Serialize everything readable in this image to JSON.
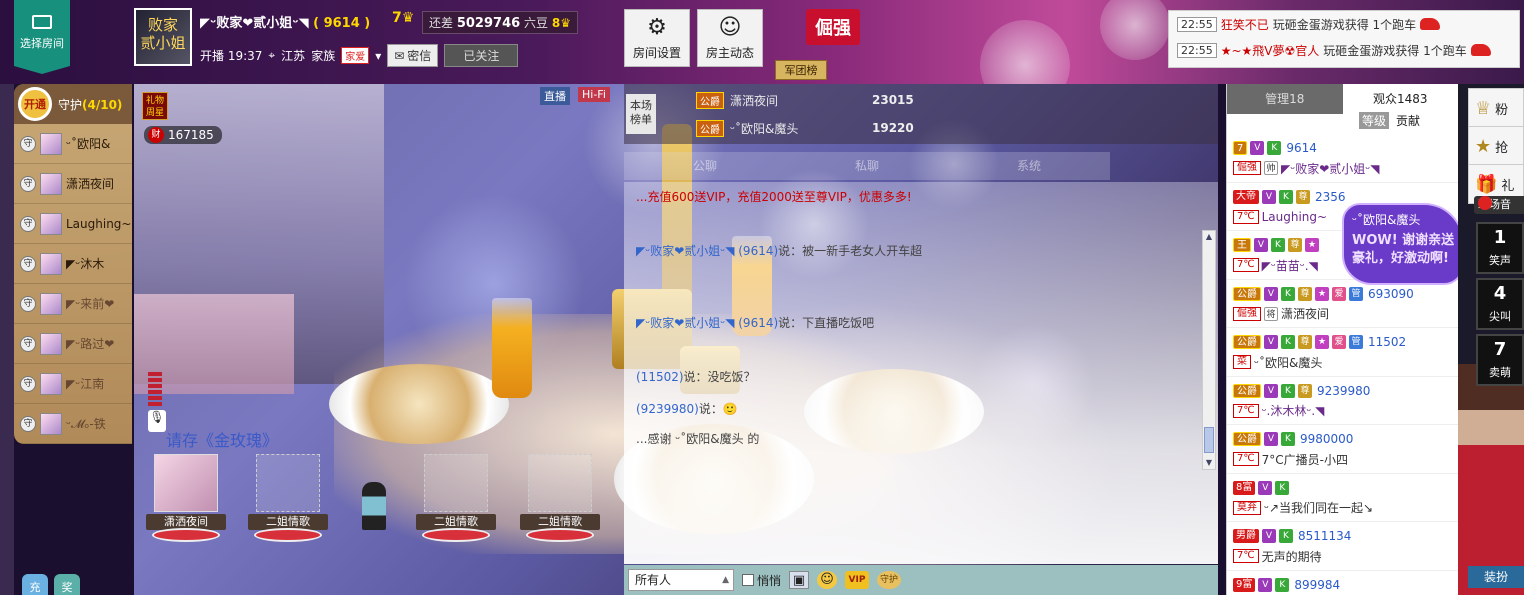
{
  "top": {
    "choose_room": "选择房间",
    "host_name": "◤ᵕ败家❤贰小姐ᵕ◥",
    "host_id": "( 9614 )",
    "host_level": "7",
    "diff_label": "还差",
    "diff_value": "5029746",
    "diff_suffix": "六豆",
    "diff_level": "8",
    "live_time": "开播 19:37",
    "location": "江苏",
    "family_label": "家族",
    "family_tag": "家爱",
    "msg_label": "密信",
    "follow_label": "已关注",
    "room_settings": "房间设置",
    "host_dynamics": "房主动态",
    "badge": "倔强",
    "legion": "军团榜",
    "notices": [
      {
        "time": "22:55",
        "user": "狂笑不已",
        "text": "玩砸金蛋游戏获得 1个跑车"
      },
      {
        "time": "22:55",
        "user": "★~★飛V夢☢官人",
        "text": "玩砸金蛋游戏获得 1个跑车"
      }
    ]
  },
  "guard": {
    "open": "开通",
    "title": "守护",
    "count": "(4/10)",
    "items": [
      {
        "name": "ᵕ˚欧阳&",
        "dim": false
      },
      {
        "name": "潇洒夜间",
        "dim": false
      },
      {
        "name": "Laughing~",
        "dim": false
      },
      {
        "name": "◤ᵕ沐木",
        "dim": false
      },
      {
        "name": "◤ᵕ来前❤",
        "dim": true
      },
      {
        "name": "◤ᵕ路过❤",
        "dim": true
      },
      {
        "name": "◤ᵕ江南",
        "dim": true
      },
      {
        "name": "ᵕ𝓜ₒ-铁",
        "dim": true
      }
    ],
    "btn_charge": "充",
    "btn_award": "奖"
  },
  "video": {
    "live": "直播",
    "hifi": "Hi-Fi",
    "gift_week": "礼物周星",
    "wealth_icon": "财",
    "wealth_value": "167185",
    "scroll_text": "请存《金玫瑰》",
    "mic_seats": [
      {
        "label": "潇洒夜间",
        "empty": false
      },
      {
        "label": "二姐情歌",
        "empty": true
      },
      {
        "label": "二姐情歌",
        "empty": true
      },
      {
        "label": "二姐情歌",
        "empty": true
      }
    ]
  },
  "chat": {
    "rank_tab": "本场榜单",
    "rank": [
      {
        "tag": "公爵",
        "name": "潇洒夜间",
        "value": "23015"
      },
      {
        "tag": "公爵",
        "name": "ᵕ˚欧阳&魔头",
        "value": "19220"
      }
    ],
    "tabs": [
      "公聊",
      "私聊",
      "系统"
    ],
    "lines": [
      {
        "speaker": "",
        "text": "...充值600送VIP，充值2000送至尊VIP，优惠多多!",
        "cls": "red"
      },
      {
        "speaker": "◤ᵕ败家❤贰小姐ᵕ◥ (9614)",
        "text": "说：被一新手老女人开车超",
        "cls": ""
      },
      {
        "speaker": "◤ᵕ败家❤贰小姐ᵕ◥ (9614)",
        "text": "说：下直播吃饭吧",
        "cls": ""
      },
      {
        "speaker": "(11502)",
        "text": "说：没吃饭？",
        "cls": ""
      },
      {
        "speaker": "(9239980)",
        "text": "说：🙂",
        "cls": ""
      },
      {
        "speaker": "",
        "text": "...感谢 ᵕ˚欧阳&魔头 的",
        "cls": "gr"
      }
    ],
    "to_select": "所有人",
    "whisper": "悄悄",
    "vip": "VIP",
    "guard": "守护"
  },
  "audience": {
    "tab_manager": "管理18",
    "tab_audience": "观众1483",
    "sub_level": "等级",
    "sub_contrib": "贡献",
    "items": [
      {
        "lvl": "7",
        "lvlcls": "gold",
        "tags": [
          "V",
          "K"
        ],
        "num": "9614",
        "temp": "倔强",
        "handsome": "帅",
        "name": "◤ᵕ败家❤贰小姐ᵕ◥",
        "purple": true
      },
      {
        "lvl": "大帝",
        "lvlcls": "red",
        "tags": [
          "V",
          "K",
          "尊"
        ],
        "num": "2356",
        "temp": "7℃",
        "handsome": "",
        "name": "Laughing~",
        "purple": true
      },
      {
        "lvl": "王",
        "lvlcls": "gold",
        "tags": [
          "V",
          "K",
          "尊",
          "★"
        ],
        "num": "",
        "temp": "7℃",
        "handsome": "",
        "name": "◤ᵕ苗苗ᵕ.◥",
        "purple": true
      },
      {
        "lvl": "公爵",
        "lvlcls": "gold",
        "tags": [
          "V",
          "K",
          "尊",
          "★",
          "爱",
          "管"
        ],
        "num": "693090",
        "temp": "倔强",
        "handsome": "将",
        "name": "潇洒夜间",
        "purple": false
      },
      {
        "lvl": "公爵",
        "lvlcls": "gold",
        "tags": [
          "V",
          "K",
          "尊",
          "★",
          "爱",
          "管"
        ],
        "num": "11502",
        "temp": "菜",
        "handsome": "",
        "name": "ᵕ˚欧阳&魔头",
        "purple": false
      },
      {
        "lvl": "公爵",
        "lvlcls": "gold",
        "tags": [
          "V",
          "K",
          "尊"
        ],
        "num": "9239980",
        "temp": "7℃",
        "handsome": "",
        "name": "ᵕ.沐木林ᵕ.◥",
        "purple": true
      },
      {
        "lvl": "公爵",
        "lvlcls": "gold",
        "tags": [
          "V",
          "K"
        ],
        "num": "9980000",
        "temp": "7℃",
        "handsome": "",
        "name": "7°C广播员-小四",
        "purple": false
      },
      {
        "lvl": "8富",
        "lvlcls": "red",
        "tags": [
          "V",
          "K"
        ],
        "num": "",
        "temp": "莫弃",
        "handsome": "",
        "name": "ᵕ↗当我们同在一起↘",
        "purple": false
      },
      {
        "lvl": "男爵",
        "lvlcls": "red",
        "tags": [
          "V",
          "K"
        ],
        "num": "8511134",
        "temp": "7℃",
        "handsome": "",
        "name": "无声的期待",
        "purple": false
      },
      {
        "lvl": "9富",
        "lvlcls": "red",
        "tags": [
          "V",
          "K"
        ],
        "num": "899984",
        "temp": "",
        "handsome": "",
        "name": "",
        "purple": false
      }
    ]
  },
  "bubble": {
    "who": "ᵕ˚欧阳&魔头",
    "msg": "WOW! 谢谢亲送豪礼，好激动啊!"
  },
  "right_strip": {
    "fans": "粉",
    "grab": "抢",
    "gift": "礼",
    "scene_label": "现场音",
    "scenes": [
      {
        "n": "1",
        "l": "笑声"
      },
      {
        "n": "4",
        "l": "尖叫"
      },
      {
        "n": "7",
        "l": "卖萌"
      }
    ],
    "dress": "装扮"
  }
}
